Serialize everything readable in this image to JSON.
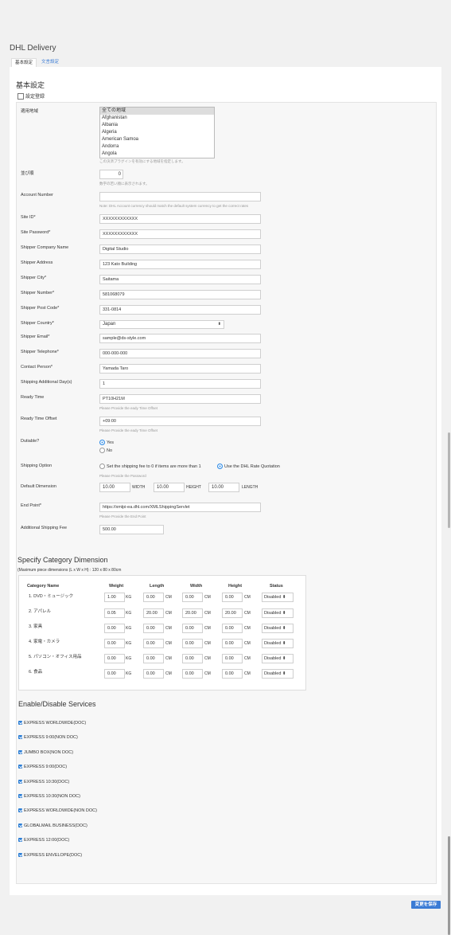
{
  "page": {
    "title": "DHL Delivery"
  },
  "tabs": [
    {
      "label": "基本設定"
    },
    {
      "label": "文言設定"
    }
  ],
  "section": {
    "title": "基本設定",
    "register_link": "設定登録"
  },
  "form": {
    "region": {
      "label": "適用地域",
      "options": [
        "全ての地域",
        "Afghanistan",
        "Albania",
        "Algeria",
        "American Samoa",
        "Andorra",
        "Angola"
      ],
      "help": "この決済プラグインを有効にする地域を指定します。"
    },
    "order": {
      "label": "並び順",
      "value": "0",
      "help": "数字の若い順に表示されます。"
    },
    "account_number": {
      "label": "Account Number",
      "value": "",
      "help": "Note: DHL Account currency should match the default system currency to get the correct rates"
    },
    "site_id": {
      "label": "Site ID*",
      "value": "XXXXXXXXXXXX"
    },
    "site_password": {
      "label": "Site Password*",
      "value": "XXXXXXXXXXXX"
    },
    "shipper_company": {
      "label": "Shipper Company Name",
      "value": "Digital Studio"
    },
    "shipper_address": {
      "label": "Shipper Address",
      "value": "123 Kato Building"
    },
    "shipper_city": {
      "label": "Shipper City*",
      "value": "Saitama"
    },
    "shipper_number": {
      "label": "Shipper Number*",
      "value": "581068079"
    },
    "shipper_post": {
      "label": "Shipper Post Code*",
      "value": "331-0814"
    },
    "shipper_country": {
      "label": "Shipper Country*",
      "value": "Japan"
    },
    "shipper_email": {
      "label": "Shipper Email*",
      "value": "sample@ds-style.com"
    },
    "shipper_tel": {
      "label": "Shipper Telephone*",
      "value": "000-000-000"
    },
    "contact_person": {
      "label": "Contact Person*",
      "value": "Yamada Taro"
    },
    "additional_days": {
      "label": "Shipping Additional Day(s)",
      "value": "1"
    },
    "ready_time": {
      "label": "Ready Time",
      "value": "PT10H21M",
      "help": "Please Provide the eady Time Offset"
    },
    "ready_offset": {
      "label": "Ready Time Offset",
      "value": "+09:00",
      "help": "Please Provide the eady Time Offset"
    },
    "dutiable": {
      "label": "Dutiable?",
      "yes": "Yes",
      "no": "No"
    },
    "shipping_option": {
      "label": "Shipping Option",
      "opt1": "Set the shipping fee to 0 if items are more than 1",
      "opt2": "Use the DHL Rate Quotation",
      "help": "Please Provide the Password"
    },
    "default_dimension": {
      "label": "Default Dimension",
      "width": "10.00",
      "width_label": "WIDTH",
      "height": "10.00",
      "height_label": "HEIGHT",
      "length": "10.00",
      "length_label": "LENGTH"
    },
    "end_point": {
      "label": "End Point*",
      "value": "https://xmlpi-ea.dhl.com/XMLShippingServlet",
      "help": "Please Provide the End Point"
    },
    "additional_fee": {
      "label": "Additional Shipping Fee",
      "value": "500.00"
    }
  },
  "category": {
    "title": "Specify Category Dimension",
    "note": "(Maximum piece dimensions (L x W x H) : 120 x 80 x 80cm",
    "headers": [
      "Category Name",
      "Weight",
      "Length",
      "Width",
      "Height",
      "Status"
    ],
    "unit_kg": "KG",
    "unit_cm": "CM",
    "rows": [
      {
        "name": "1. DVD・ミュージック",
        "weight": "1.00",
        "length": "0.00",
        "width": "0.00",
        "height": "0.00",
        "status": "Disabled ⬍"
      },
      {
        "name": "2. アパレル",
        "weight": "0.05",
        "length": "20.00",
        "width": "20.00",
        "height": "20.00",
        "status": "Disabled ⬍"
      },
      {
        "name": "3. 家具",
        "weight": "0.00",
        "length": "0.00",
        "width": "0.00",
        "height": "0.00",
        "status": "Disabled ⬍"
      },
      {
        "name": "4. 家電・カメラ",
        "weight": "0.00",
        "length": "0.00",
        "width": "0.00",
        "height": "0.00",
        "status": "Disabled ⬍"
      },
      {
        "name": "5. パソコン・オフィス用品",
        "weight": "0.00",
        "length": "0.00",
        "width": "0.00",
        "height": "0.00",
        "status": "Disabled ⬍"
      },
      {
        "name": "6. 食品",
        "weight": "0.00",
        "length": "0.00",
        "width": "0.00",
        "height": "0.00",
        "status": "Disabled ⬍"
      }
    ]
  },
  "services": {
    "title": "Enable/Disable Services",
    "items": [
      "EXPRESS WORLDWIDE(DOC)",
      "EXPRESS 9:00(NON DOC)",
      "JUMBO BOX(NON DOC)",
      "EXPRESS 9:00(DOC)",
      "EXPRESS 10:30(DOC)",
      "EXPRESS 10:30(NON DOC)",
      "EXPRESS WORLDWIDE(NON DOC)",
      "GLOBALMAIL BUSINESS(DOC)",
      "EXPRESS 12:00(DOC)",
      "EXPRESS ENVELOPE(DOC)"
    ]
  },
  "footer": {
    "save_label": "変更を保存"
  }
}
